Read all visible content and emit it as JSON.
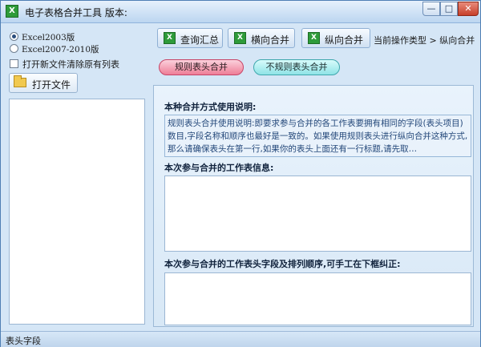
{
  "window": {
    "title": "电子表格合并工具 版本:",
    "minimize_glyph": "—",
    "maximize_glyph": "□",
    "close_glyph": "✕"
  },
  "left": {
    "radio_options": [
      "Excel2003版",
      "Excel2007-2010版"
    ],
    "radio_selected": "Excel2003版",
    "checkbox_label": "打开新文件清除原有列表",
    "open_button_label": "打开文件"
  },
  "tabs": [
    {
      "label": "查询汇总",
      "icon": "excel-icon"
    },
    {
      "label": "横向合并",
      "icon": "excel-icon"
    },
    {
      "label": "纵向合并",
      "icon": "excel-icon"
    }
  ],
  "breadcrumb": "当前操作类型 > 纵向合并",
  "mode_buttons": {
    "rule": "规则表头合并",
    "irregular": "不规则表头合并"
  },
  "content": {
    "usage_title": "本种合并方式使用说明:",
    "usage_text": "规则表头合并使用说明:即要求参与合并的各工作表要拥有相同的字段(表头项目)数目,字段名称和顺序也最好是一致的。如果使用规则表头进行纵向合并这种方式,那么请确保表头在第一行,如果你的表头上面还有一行标题,请先取…",
    "sheet_info_title": "本次参与合并的工作表信息:",
    "header_fields_title": "本次参与合并的工作表头字段及排列顺序,可手工在下框纠正:"
  },
  "status": {
    "text": "表头字段"
  }
}
